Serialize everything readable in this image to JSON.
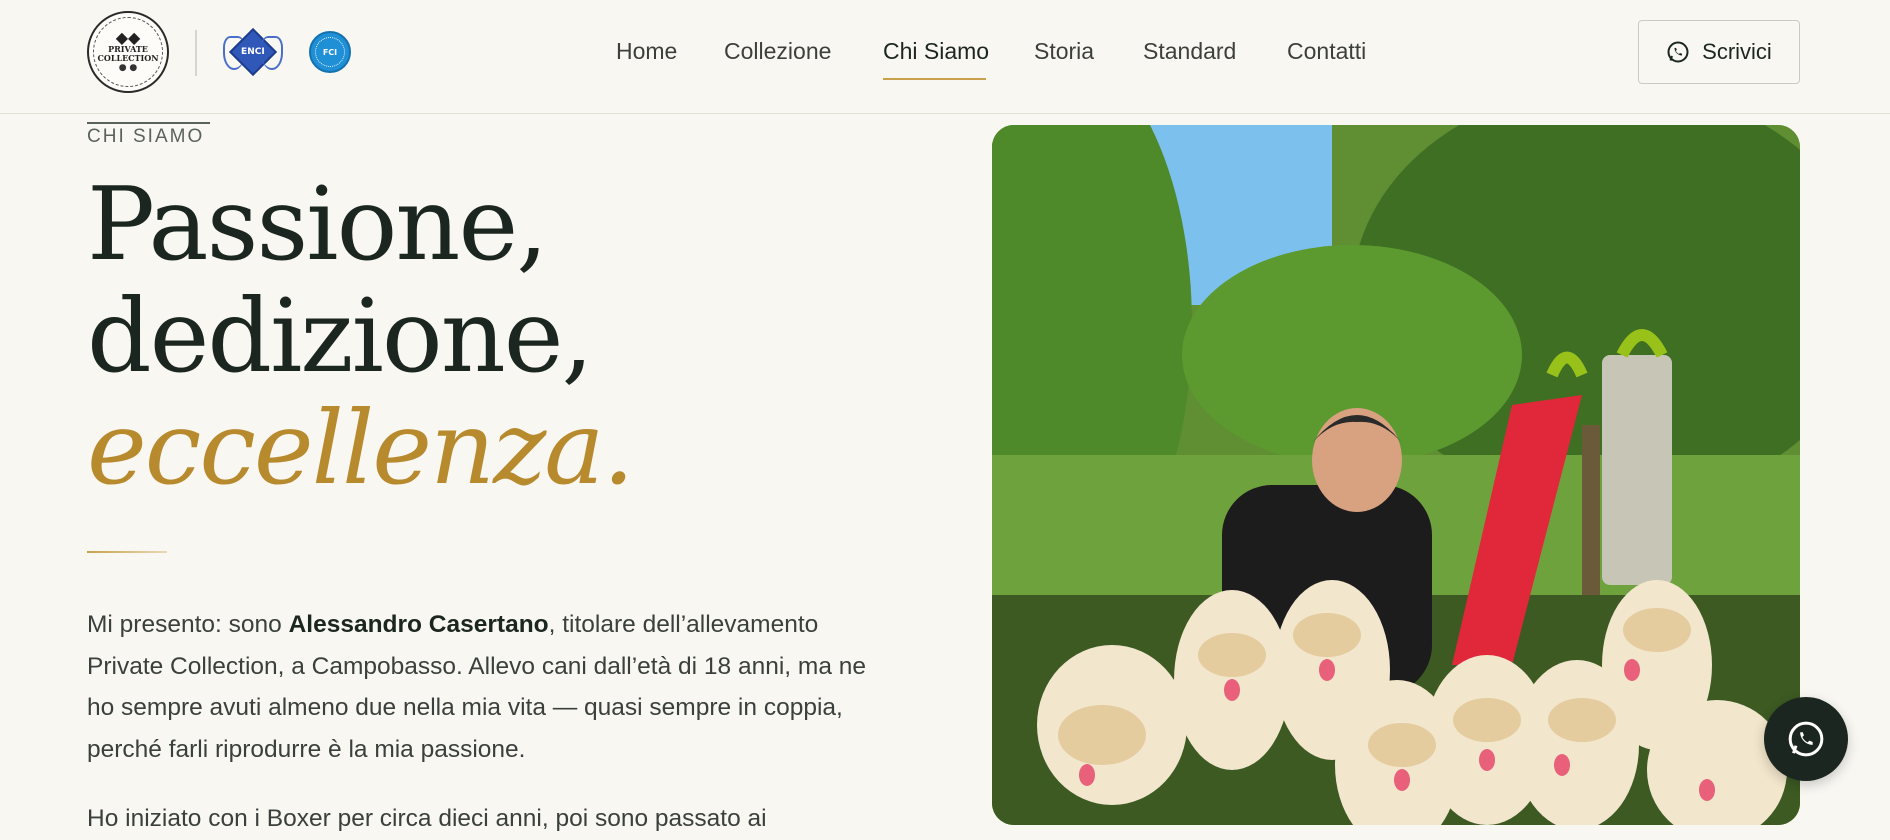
{
  "header": {
    "seal_logo": {
      "text_line1": "PRIVATE",
      "text_line2": "COLLECTION"
    },
    "enci_logo": {
      "text": "ENCI"
    },
    "fci_logo": {
      "text": "FCI"
    },
    "nav": [
      {
        "label": "Home"
      },
      {
        "label": "Collezione"
      },
      {
        "label": "Chi Siamo",
        "active": true
      },
      {
        "label": "Storia"
      },
      {
        "label": "Standard"
      },
      {
        "label": "Contatti"
      }
    ],
    "cta": {
      "label": "Scrivici",
      "icon": "whatsapp-icon"
    }
  },
  "hero": {
    "eyebrow": "CHI SIAMO",
    "title_line1": "Passione,",
    "title_line2": "dedizione,",
    "title_line3": "eccellenza.",
    "intro_prefix": "Mi presento: sono ",
    "intro_name": "Alessandro Casertano",
    "intro_suffix": ", titolare dell’allevamento Private Collection, a Campobasso. Allevo cani dall’età di 18 anni, ma ne ho sempre avuti almeno due nella mia vita — quasi sempre in coppia, perché farli riprodurre è la mia passione.",
    "second_paragraph": "Ho iniziato con i Boxer per circa dieci anni, poi sono passato ai"
  },
  "photo": {
    "subject": "breeder-with-golden-retriever-puppies"
  },
  "floating": {
    "icon": "whatsapp-icon"
  },
  "colors": {
    "accent": "#c8a14c",
    "dark": "#1c2620",
    "background": "#f9f7f2"
  }
}
